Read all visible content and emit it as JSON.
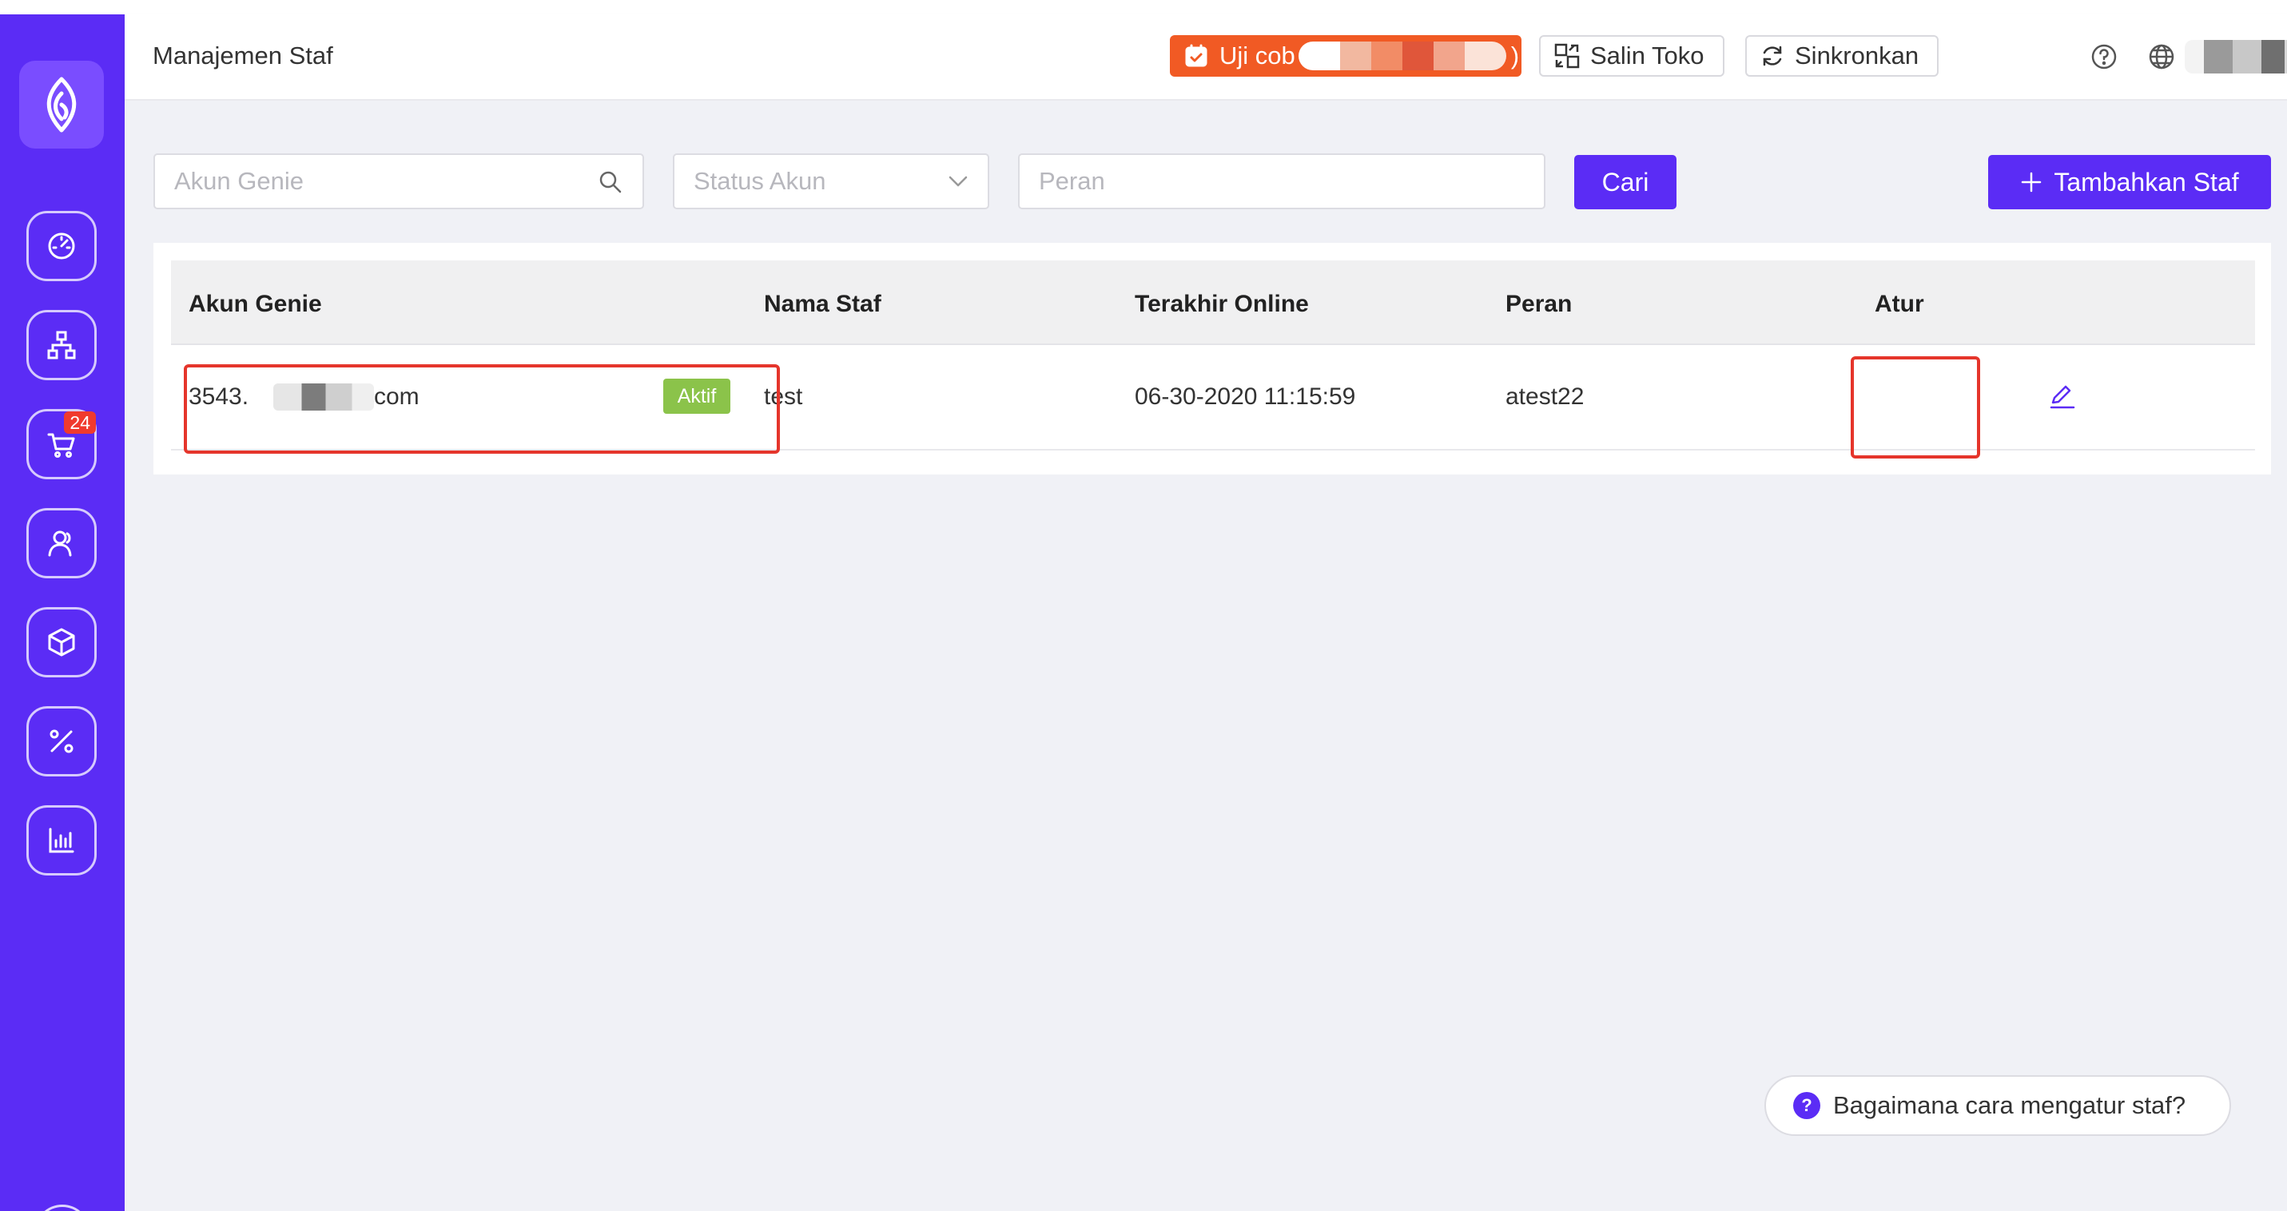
{
  "header": {
    "page_title": "Manajemen Staf",
    "trial_label": "Uji cob",
    "trial_suffix": ")",
    "copy_store_label": "Salin Toko",
    "sync_label": "Sinkronkan"
  },
  "sidebar": {
    "items": [
      {
        "name": "dashboard",
        "icon": "speedometer-icon"
      },
      {
        "name": "organization",
        "icon": "hierarchy-icon"
      },
      {
        "name": "orders",
        "icon": "cart-icon",
        "badge": "24"
      },
      {
        "name": "customers",
        "icon": "users-icon"
      },
      {
        "name": "products",
        "icon": "box-icon"
      },
      {
        "name": "promotions",
        "icon": "percent-icon"
      },
      {
        "name": "reports",
        "icon": "bar-chart-icon"
      }
    ]
  },
  "filters": {
    "account_placeholder": "Akun Genie",
    "status_placeholder": "Status Akun",
    "role_placeholder": "Peran",
    "search_label": "Cari",
    "add_staff_label": "Tambahkan Staf"
  },
  "table": {
    "headers": {
      "account": "Akun Genie",
      "name": "Nama Staf",
      "last_online": "Terakhir Online",
      "role": "Peran",
      "manage": "Atur"
    },
    "rows": [
      {
        "account_prefix": "3543.",
        "account_suffix": "com",
        "status": "Aktif",
        "name": "test",
        "last_online": "06-30-2020 11:15:59",
        "role": "atest22"
      }
    ]
  },
  "help": {
    "label": "Bagaimana cara mengatur staf?"
  },
  "colors": {
    "brand": "#5b2cf5",
    "trial": "#f15a24",
    "active_badge": "#8bc34a",
    "highlight": "#e5352b"
  }
}
